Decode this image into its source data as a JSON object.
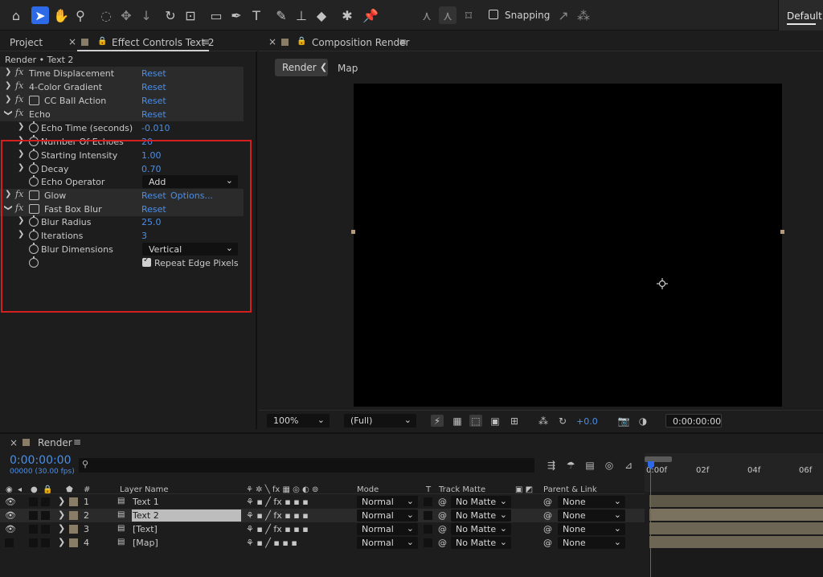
{
  "toolbar": {
    "snapping_label": "Snapping",
    "workspace_label": "Default"
  },
  "left_panel": {
    "tab_project": "Project",
    "tab_effect_controls": "Effect Controls Text 2",
    "title": "Render • Text 2",
    "effects": [
      {
        "name": "Time Displacement",
        "value": "Reset"
      },
      {
        "name": "4-Color Gradient",
        "value": "Reset"
      },
      {
        "name": "CC Ball Action",
        "value": "Reset"
      },
      {
        "name": "Echo",
        "value": "Reset"
      },
      {
        "name": "Echo Time (seconds)",
        "value": "-0.010"
      },
      {
        "name": "Number Of Echoes",
        "value": "20"
      },
      {
        "name": "Starting Intensity",
        "value": "1.00"
      },
      {
        "name": "Decay",
        "value": "0.70"
      },
      {
        "name": "Echo Operator",
        "value": "Add"
      },
      {
        "name": "Glow",
        "value": "Reset",
        "options": "Options..."
      },
      {
        "name": "Fast Box Blur",
        "value": "Reset"
      },
      {
        "name": "Blur Radius",
        "value": "25.0"
      },
      {
        "name": "Iterations",
        "value": "3"
      },
      {
        "name": "Blur Dimensions",
        "value": "Vertical"
      },
      {
        "name": "",
        "value": "Repeat Edge Pixels"
      }
    ]
  },
  "comp_panel": {
    "tab_title": "Composition Render",
    "breadcrumb_render": "Render",
    "breadcrumb_map": "Map",
    "zoom": "100%",
    "resolution": "(Full)",
    "exposure": "+0.0",
    "timecode": "0:00:00:00"
  },
  "timeline": {
    "tab_title": "Render",
    "timecode": "0:00:00:00",
    "frames": "00000 (30.00 fps)",
    "columns": {
      "num": "#",
      "layer_name": "Layer Name",
      "mode": "Mode",
      "t": "T",
      "track_matte": "Track Matte",
      "parent": "Parent & Link"
    },
    "ruler": [
      "0:00f",
      "02f",
      "04f",
      "06f"
    ],
    "layers": [
      {
        "num": "1",
        "name": "Text 1",
        "mode": "Normal",
        "matte": "No Matte",
        "parent": "None"
      },
      {
        "num": "2",
        "name": "Text 2",
        "mode": "Normal",
        "matte": "No Matte",
        "parent": "None"
      },
      {
        "num": "3",
        "name": "[Text]",
        "mode": "Normal",
        "matte": "No Matte",
        "parent": "None"
      },
      {
        "num": "4",
        "name": "[Map]",
        "mode": "Normal",
        "matte": "No Matte",
        "parent": "None"
      }
    ]
  }
}
